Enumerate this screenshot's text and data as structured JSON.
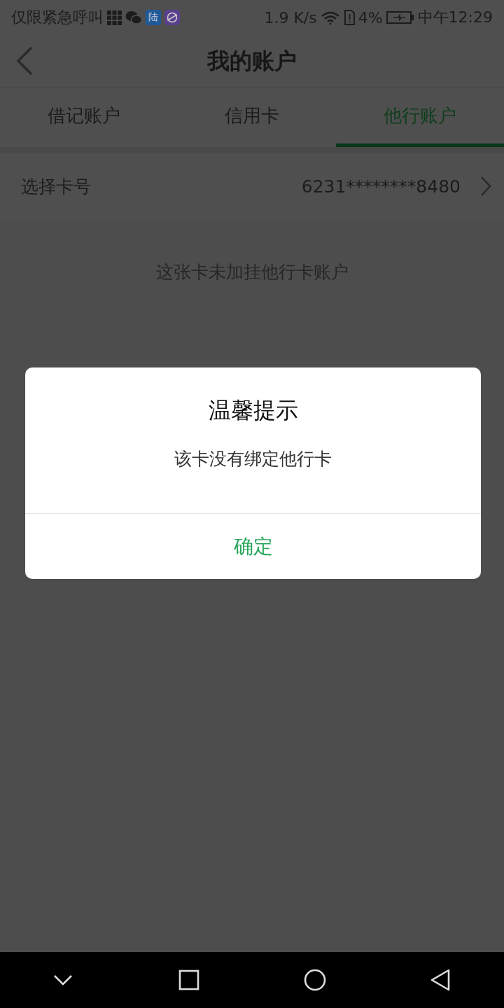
{
  "status_bar": {
    "carrier": "仅限紧急呼叫",
    "app_badge": "陆",
    "speed": "1.9 K/s",
    "battery": "4%",
    "time": "中午12:29"
  },
  "header": {
    "title": "我的账户"
  },
  "tabs": [
    {
      "label": "借记账户",
      "selected": false
    },
    {
      "label": "信用卡",
      "selected": false
    },
    {
      "label": "他行账户",
      "selected": true
    }
  ],
  "card_row": {
    "label": "选择卡号",
    "value": "6231********8480"
  },
  "empty_message": "这张卡未加挂他行卡账户",
  "dialog": {
    "title": "温馨提示",
    "message": "该卡没有绑定他行卡",
    "button": "确定"
  }
}
